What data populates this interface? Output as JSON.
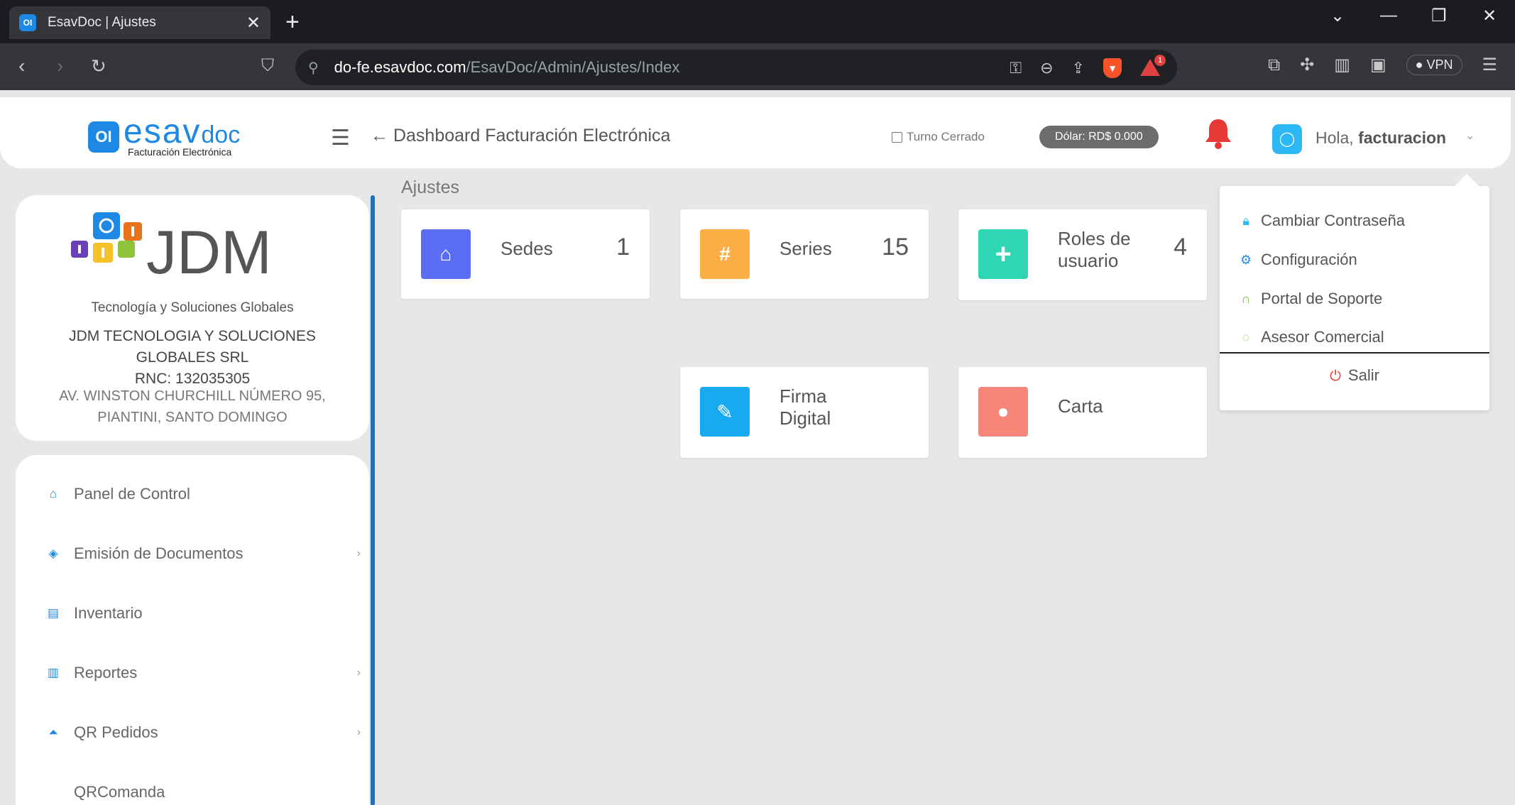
{
  "browser": {
    "tab_title": "EsavDoc | Ajustes",
    "tab_favicon": "OI",
    "url_host": "do-fe.esavdoc.com",
    "url_path": "/EsavDoc/Admin/Ajustes/Index",
    "vpn_label": "VPN",
    "notification_count": "1"
  },
  "header": {
    "logo_mark": "OI",
    "logo_esav": "esav",
    "logo_doc": "doc",
    "logo_sub": "Facturación Electrónica",
    "dashboard_title": "Dashboard Facturación Electrónica",
    "turno_label": "Turno Cerrado",
    "dolar_label": "Dólar: RD$ 0.000",
    "greeting": "Hola,",
    "username": "facturacion"
  },
  "company": {
    "logo_text": "JDM",
    "tagline": "Tecnología y Soluciones Globales",
    "name": "JDM TECNOLOGIA Y SOLUCIONES GLOBALES SRL",
    "rnc": "RNC: 132035305",
    "address": "AV. WINSTON CHURCHILL NÚMERO 95, PIANTINI, SANTO DOMINGO"
  },
  "sidebar": {
    "items": [
      {
        "label": "Panel de Control",
        "icon": "home-icon"
      },
      {
        "label": "Emisión de Documentos",
        "icon": "layers-icon"
      },
      {
        "label": "Inventario",
        "icon": "list-icon"
      },
      {
        "label": "Reportes",
        "icon": "bar-chart-icon"
      },
      {
        "label": "QR Pedidos",
        "icon": "bell-service-icon"
      },
      {
        "label": "QRComanda",
        "icon": ""
      }
    ]
  },
  "main": {
    "page_title": "Ajustes",
    "cards": [
      {
        "label": "Sedes",
        "count": "1",
        "icon": "home-icon",
        "color": "#5b6cf6"
      },
      {
        "label": "Series",
        "count": "15",
        "icon": "hash-icon",
        "color": "#fdae44"
      },
      {
        "label": "Roles de usuario",
        "count": "4",
        "icon": "plus-icon",
        "color": "#2fd6b4"
      },
      {
        "label": "Firma Digital",
        "count": "",
        "icon": "edit-icon",
        "color": "#17a9f2"
      },
      {
        "label": "Carta",
        "count": "",
        "icon": "fire-icon",
        "color": "#f8857a"
      }
    ]
  },
  "user_menu": {
    "items": [
      {
        "label": "Cambiar Contraseña",
        "icon": "lock-icon",
        "color": "#2cb7f5"
      },
      {
        "label": "Configuración",
        "icon": "gear-icon",
        "color": "#1e88e5"
      },
      {
        "label": "Portal de Soporte",
        "icon": "headset-icon",
        "color": "#7cc53c"
      },
      {
        "label": "Asesor Comercial",
        "icon": "whatsapp-icon",
        "color": "#7cc53c"
      }
    ],
    "logout_label": "Salir"
  }
}
